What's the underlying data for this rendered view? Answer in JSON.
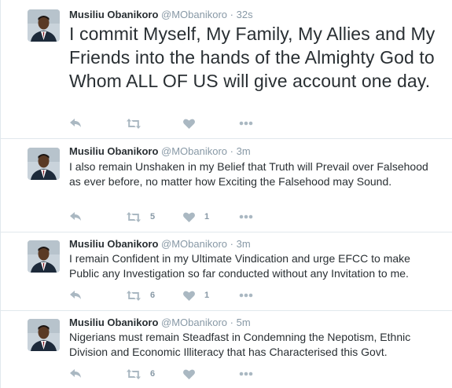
{
  "tweets": [
    {
      "name": "Musiliu Obanikoro",
      "handle": "@MObanikoro",
      "separator": "·",
      "time": "32s",
      "text": "I commit Myself, My Family, My Allies and My Friends into the hands of the Almighty God to Whom ALL OF US will give account one day.",
      "retweets": "",
      "likes": ""
    },
    {
      "name": "Musiliu Obanikoro",
      "handle": "@MObanikoro",
      "separator": "·",
      "time": "3m",
      "text": "I also remain Unshaken in my Belief that Truth will Prevail over Falsehood as ever before, no matter how Exciting the Falsehood may Sound.",
      "retweets": "5",
      "likes": "1"
    },
    {
      "name": "Musiliu Obanikoro",
      "handle": "@MObanikoro",
      "separator": "·",
      "time": "3m",
      "text": "I remain Confident in my Ultimate Vindication and urge EFCC to make Public any Investigation so far conducted without any Invitation to me.",
      "retweets": "6",
      "likes": "1"
    },
    {
      "name": "Musiliu Obanikoro",
      "handle": "@MObanikoro",
      "separator": "·",
      "time": "5m",
      "text": "Nigerians must remain Steadfast in Condemning the Nepotism, Ethnic Division and Economic Illiteracy that has Characterised this Govt.",
      "retweets": "6",
      "likes": ""
    }
  ],
  "icons": {
    "reply": "reply-icon",
    "retweet": "retweet-icon",
    "like": "heart-icon",
    "more": "more-icon",
    "avatar": "avatar"
  },
  "colors": {
    "name": "#292f33",
    "meta": "#8899a6",
    "icon": "#aab8c2",
    "border": "#e1e8ed"
  }
}
